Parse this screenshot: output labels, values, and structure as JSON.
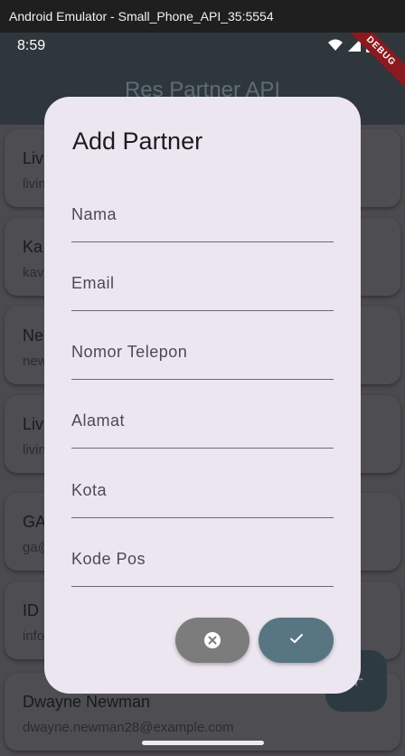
{
  "window": {
    "title": "Android Emulator - Small_Phone_API_35:5554"
  },
  "status": {
    "time": "8:59"
  },
  "app": {
    "title": "Res Partner API",
    "debug_label": "DEBUG",
    "fab_icon": "add-icon"
  },
  "partners": [
    {
      "name": "Liv",
      "email": "livin"
    },
    {
      "name": "Ka",
      "email": "kav"
    },
    {
      "name": "Ne",
      "email": "new"
    },
    {
      "name": "Liv",
      "email": "livin"
    },
    {
      "name": "GA",
      "email": "ga@"
    },
    {
      "name": "ID",
      "email": "info"
    },
    {
      "name": "Dwayne Newman",
      "email": "dwayne.newman28@example.com"
    }
  ],
  "dialog": {
    "title": "Add Partner",
    "fields": [
      {
        "placeholder": "Nama",
        "value": ""
      },
      {
        "placeholder": "Email",
        "value": ""
      },
      {
        "placeholder": "Nomor Telepon",
        "value": ""
      },
      {
        "placeholder": "Alamat",
        "value": ""
      },
      {
        "placeholder": "Kota",
        "value": ""
      },
      {
        "placeholder": "Kode Pos",
        "value": ""
      }
    ],
    "cancel_icon": "cancel-icon",
    "save_icon": "check-icon"
  },
  "colors": {
    "dialog_bg": "#ece6f0",
    "cancel_button": "#7c7c7c",
    "save_button": "#587582"
  }
}
